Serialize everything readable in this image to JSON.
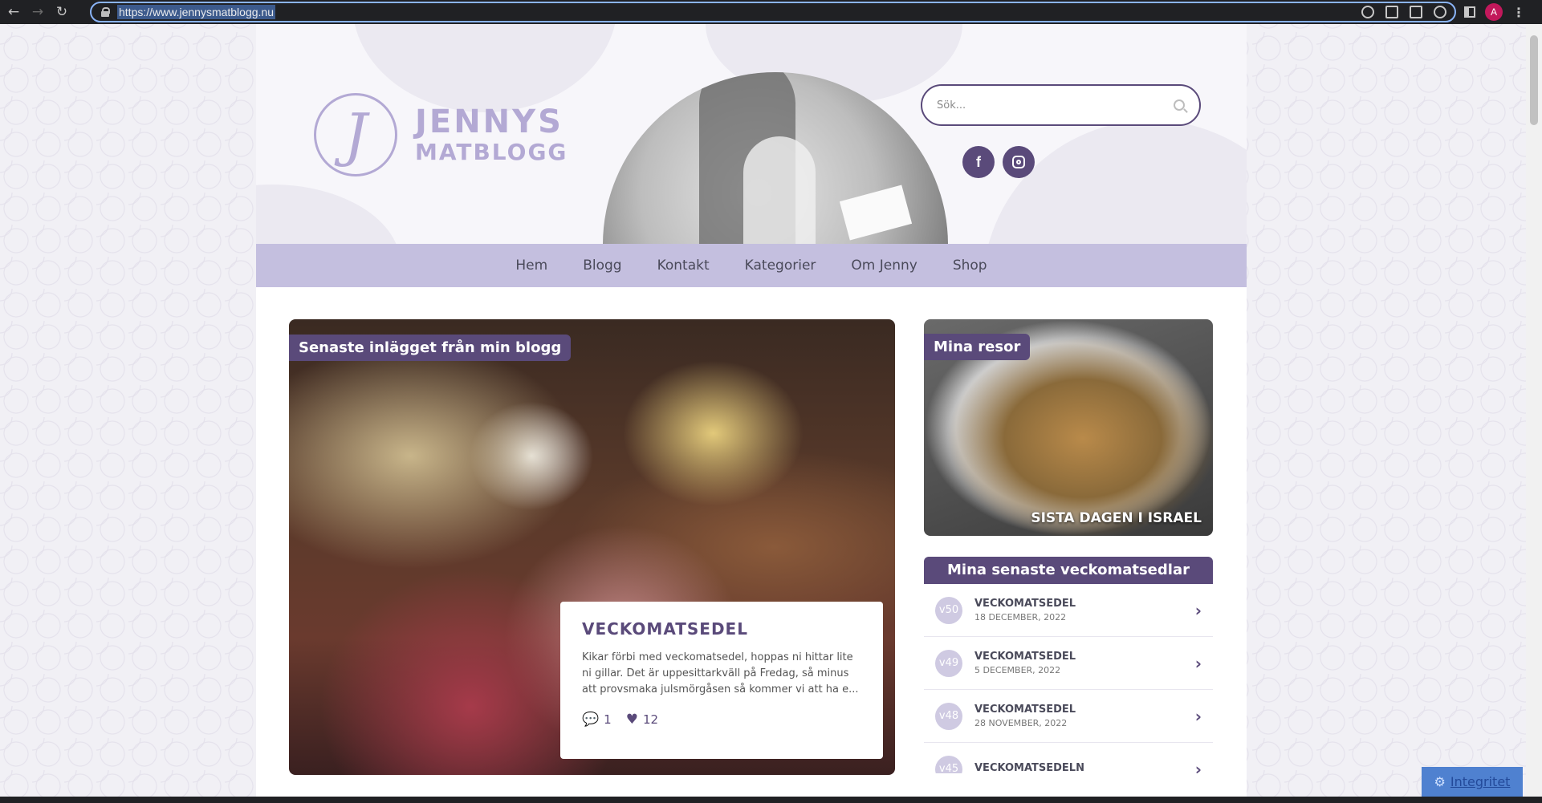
{
  "browser": {
    "url": "https://www.jennysmatblogg.nu",
    "profile_initial": "A"
  },
  "site": {
    "logo_line1": "JENNYS",
    "logo_line2": "MATBLOGG",
    "search_placeholder": "Sök...",
    "social": {
      "facebook_glyph": "f"
    }
  },
  "nav": {
    "items": [
      {
        "label": "Hem"
      },
      {
        "label": "Blogg"
      },
      {
        "label": "Kontakt"
      },
      {
        "label": "Kategorier"
      },
      {
        "label": "Om Jenny"
      },
      {
        "label": "Shop"
      }
    ]
  },
  "featured": {
    "tag": "Senaste inlägget från min blogg",
    "title": "VECKOMATSEDEL",
    "excerpt": "Kikar förbi med veckomatsedel, hoppas ni hittar lite ni gillar. Det är uppesittarkväll på Fredag, så minus att provsmaka julsmörgåsen så kommer vi att ha e...",
    "comments": "1",
    "likes": "12"
  },
  "travel": {
    "tag": "Mina resor",
    "caption": "SISTA DAGEN I ISRAEL"
  },
  "menus": {
    "header": "Mina senaste veckomatsedlar",
    "items": [
      {
        "badge": "v50",
        "title": "VECKOMATSEDEL",
        "date": "18 DECEMBER, 2022"
      },
      {
        "badge": "v49",
        "title": "VECKOMATSEDEL",
        "date": "5 DECEMBER, 2022"
      },
      {
        "badge": "v48",
        "title": "VECKOMATSEDEL",
        "date": "28 NOVEMBER, 2022"
      },
      {
        "badge": "v45",
        "title": "VECKOMATSEDELN",
        "date": ""
      }
    ]
  },
  "privacy": {
    "label": "Integritet"
  },
  "colors": {
    "brand_purple": "#5a4a7a",
    "nav_lilac": "#c4bfdf",
    "logo_lilac": "#b3a9d4"
  }
}
